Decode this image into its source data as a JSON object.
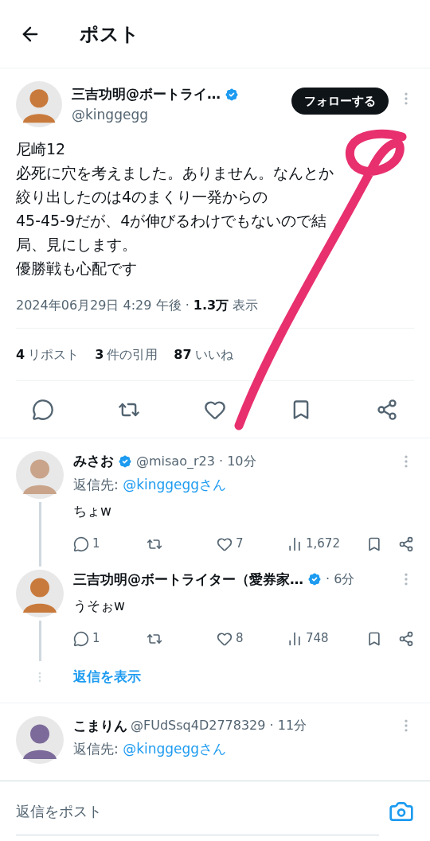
{
  "header": {
    "title": "ポスト"
  },
  "post": {
    "author": "三吉功明@ボートライ…",
    "verified": true,
    "handle": "@kinggegg",
    "follow_button": "フォローする",
    "lines": [
      "尼崎12",
      "必死に穴を考えました。ありません。なんとか",
      "絞り出したのは4のまくり一発からの",
      "45-45-9だが、4が伸びるわけでもないので結",
      "局、見にします。",
      "優勝戦も心配です"
    ],
    "timestamp": "2024年06月29日 4:29 午後 · ",
    "views_count": "1.3万",
    "views_label": " 表示",
    "stats": [
      {
        "count": "4",
        "label": "リポスト"
      },
      {
        "count": "3",
        "label": "件の引用"
      },
      {
        "count": "87",
        "label": "いいね"
      }
    ]
  },
  "replies": [
    {
      "color": "#c9a48a",
      "name": "みさお",
      "verified": true,
      "handle": "@misao_r23 · 10分",
      "reply_to_label": "返信先: ",
      "reply_to": "@kinggeggさん",
      "text": "ちょw",
      "replies": "1",
      "likes": "7",
      "views": "1,672",
      "thread_line": true
    },
    {
      "color": "#c87a3c",
      "name": "三吉功明@ボートライター（愛券家…",
      "verified": true,
      "handle": "· 6分",
      "text": "うそぉw",
      "replies": "1",
      "likes": "8",
      "views": "748",
      "thread_line": true,
      "show_replies": "返信を表示"
    },
    {
      "color": "#7c6b9a",
      "name": "こまりん",
      "verified": false,
      "handle": "@FUdSsq4D2778329 · 11分",
      "reply_to_label": "返信先: ",
      "reply_to": "@kinggeggさん",
      "thread_line": false
    }
  ],
  "composer": {
    "placeholder": "返信をポスト"
  }
}
